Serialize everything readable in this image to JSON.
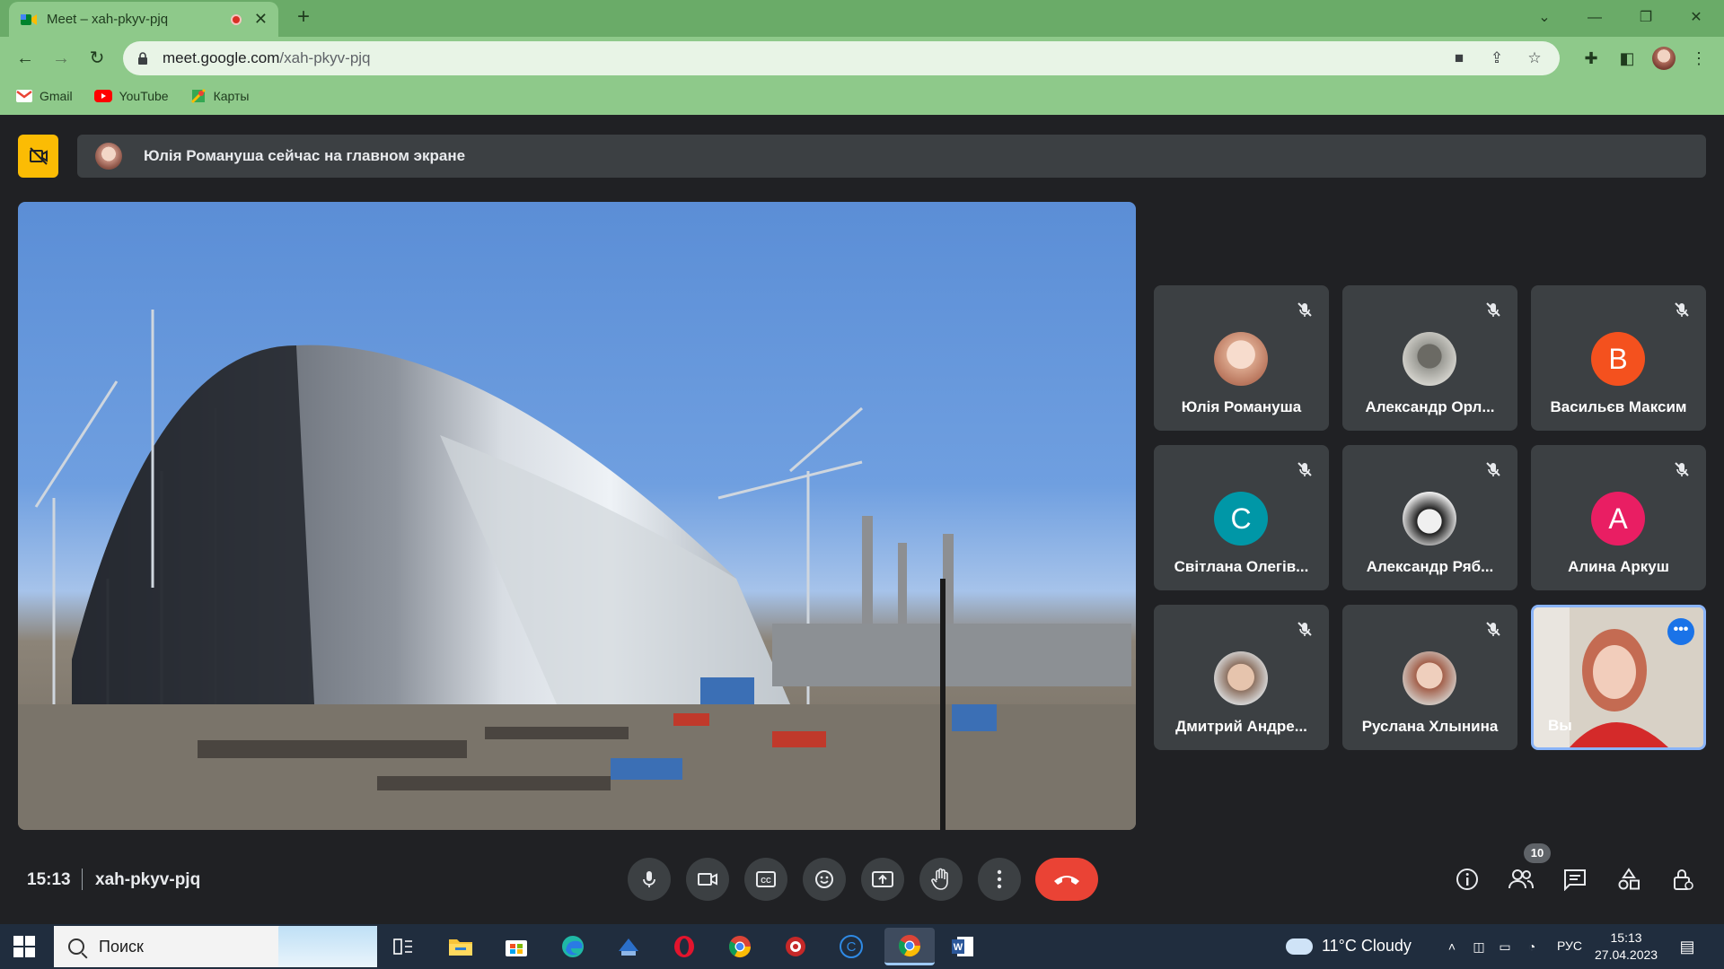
{
  "browser": {
    "tab_title": "Meet – xah-pkyv-pjq",
    "url_host": "meet.google.com",
    "url_path": "/xah-pkyv-pjq",
    "bookmarks": [
      {
        "label": "Gmail",
        "icon": "gmail-icon",
        "color": "#ea4335"
      },
      {
        "label": "YouTube",
        "icon": "youtube-icon",
        "color": "#ff0000"
      },
      {
        "label": "Карты",
        "icon": "maps-icon",
        "color": "#34a853"
      }
    ],
    "theme_color": "#8ec98a"
  },
  "meet": {
    "banner_text": "Юлія Романуша сейчас на главном экране",
    "main_video": "construction-site-video",
    "participants": [
      {
        "name": "Юлія Романуша",
        "avatar_type": "photo",
        "muted": true
      },
      {
        "name": "Александр Орл...",
        "avatar_type": "photo",
        "muted": true
      },
      {
        "name": "Васильєв Максим",
        "initial": "В",
        "color": "#f4511e",
        "muted": true
      },
      {
        "name": "Світлана Олегів...",
        "initial": "С",
        "color": "#0097a7",
        "muted": true
      },
      {
        "name": "Александр Ряб...",
        "avatar_type": "photo",
        "muted": true
      },
      {
        "name": "Алина Аркуш",
        "initial": "А",
        "color": "#e91e63",
        "muted": true
      },
      {
        "name": "Дмитрий Андре...",
        "avatar_type": "photo",
        "muted": true
      },
      {
        "name": "Руслана Хлынина",
        "avatar_type": "photo",
        "muted": true
      },
      {
        "name": "Вы",
        "avatar_type": "video",
        "muted": false
      }
    ],
    "time": "15:13",
    "meeting_code": "xah-pkyv-pjq",
    "participant_count": "10",
    "controls": [
      "mic-icon",
      "camera-icon",
      "captions-icon",
      "emoji-icon",
      "present-icon",
      "raise-hand-icon",
      "more-options-icon",
      "end-call-icon"
    ],
    "right_controls": [
      "info-icon",
      "people-icon",
      "chat-icon",
      "activities-icon",
      "host-controls-icon"
    ],
    "end_color": "#ea4335",
    "accent": "#8ab4f8"
  },
  "taskbar": {
    "search_placeholder": "Поиск",
    "weather": "11°C  Cloudy",
    "language": "РУС",
    "clock_time": "15:13",
    "clock_date": "27.04.2023"
  }
}
